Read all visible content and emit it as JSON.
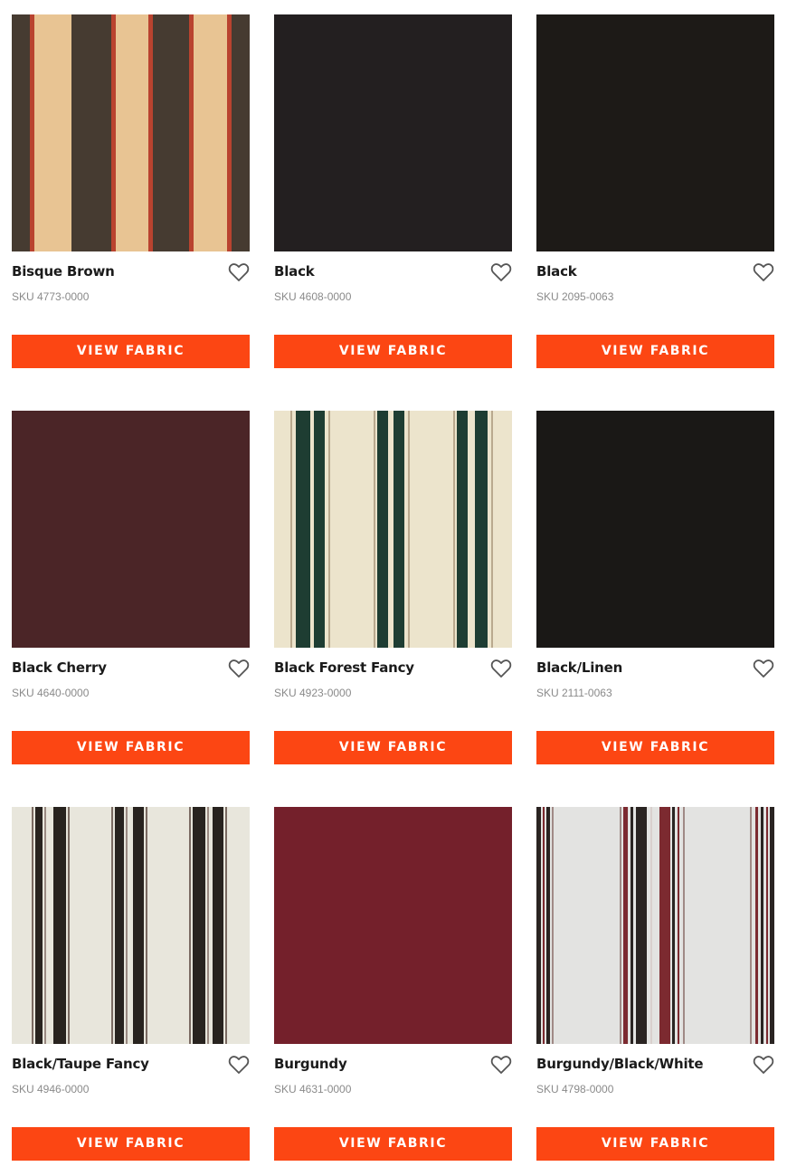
{
  "button_label": "VIEW FABRIC",
  "colors": {
    "button": "#fc4613",
    "name_text": "#1b1b1b",
    "sku_text": "#8a8a8a",
    "heart_stroke": "#555555"
  },
  "fabrics": [
    {
      "name": "Bisque Brown",
      "sku": "SKU 4773-0000",
      "swatch": "bisque-brown"
    },
    {
      "name": "Black",
      "sku": "SKU 4608-0000",
      "swatch": "black"
    },
    {
      "name": "Black",
      "sku": "SKU 2095-0063",
      "swatch": "black"
    },
    {
      "name": "Black Cherry",
      "sku": "SKU 4640-0000",
      "swatch": "black-cherry"
    },
    {
      "name": "Black Forest Fancy",
      "sku": "SKU 4923-0000",
      "swatch": "black-forest-fancy"
    },
    {
      "name": "Black/Linen",
      "sku": "SKU 2111-0063",
      "swatch": "black-linen"
    },
    {
      "name": "Black/Taupe Fancy",
      "sku": "SKU 4946-0000",
      "swatch": "black-taupe-fancy"
    },
    {
      "name": "Burgundy",
      "sku": "SKU 4631-0000",
      "swatch": "burgundy"
    },
    {
      "name": "Burgundy/Black/White",
      "sku": "SKU 4798-0000",
      "swatch": "burgundy-black-white"
    }
  ]
}
